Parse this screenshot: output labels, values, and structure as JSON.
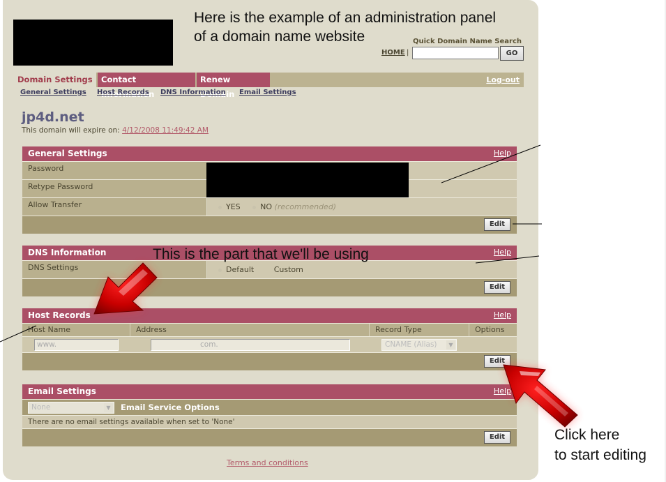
{
  "annotations": {
    "top_line1": "Here is the example of an administration panel",
    "top_line2": "of a domain name website",
    "middle": "This is the part that we'll be using",
    "bottom_line1": "Click here",
    "bottom_line2": "to start editing"
  },
  "header": {
    "quick_search_label": "Quick Domain Name Search",
    "home_link": "HOME",
    "separator": "|",
    "search_value": "",
    "go_label": "GO"
  },
  "tabs": [
    {
      "label": "Domain Settings",
      "active": true
    },
    {
      "label": "Contact Information",
      "active": false
    },
    {
      "label": "Renew Domain",
      "active": false
    }
  ],
  "logout_label": "Log-out",
  "subnav": [
    "General Settings",
    "Host Records",
    "DNS Information",
    "Email Settings"
  ],
  "domain": {
    "name": "jp4d.net",
    "expire_prefix": "This domain will expire on:",
    "expire_date": "4/12/2008 11:49:42 AM"
  },
  "general_settings": {
    "title": "General Settings",
    "help": "Help",
    "rows": [
      "Password",
      "Retype Password",
      "Allow Transfer"
    ],
    "transfer_yes": "YES",
    "transfer_no": "NO",
    "transfer_note": "(recommended)",
    "edit": "Edit"
  },
  "dns_information": {
    "title": "DNS Information",
    "help": "Help",
    "row_label": "DNS Settings",
    "option_default": "Default",
    "option_custom": "Custom",
    "edit": "Edit"
  },
  "host_records": {
    "title": "Host Records",
    "help": "Help",
    "columns": [
      "Host Name",
      "Address",
      "Record Type",
      "Options"
    ],
    "host_value": "www.",
    "address_value": "com.",
    "record_type": "CNAME (Alias)",
    "edit": "Edit"
  },
  "email_settings": {
    "title": "Email Settings",
    "help": "Help",
    "select_value": "None",
    "options_label": "Email Service Options",
    "message": "There are no email settings available when set to 'None'",
    "edit": "Edit"
  },
  "footer": {
    "terms": "Terms and conditions"
  }
}
